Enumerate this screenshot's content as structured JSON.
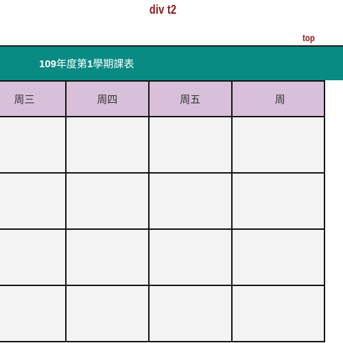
{
  "header": {
    "div_label": "div t2",
    "top_link": "top"
  },
  "title": {
    "year": "109",
    "part1": "年度第",
    "term": "1",
    "part2": "學期課表"
  },
  "table": {
    "days": [
      "周三",
      "周四",
      "周五",
      "周"
    ],
    "row_count": 4
  },
  "colors": {
    "title_bg": "#098b84",
    "header_bg": "#d8c0da",
    "cell_bg": "#f3f3f3",
    "accent_text": "#8b1a1a"
  }
}
